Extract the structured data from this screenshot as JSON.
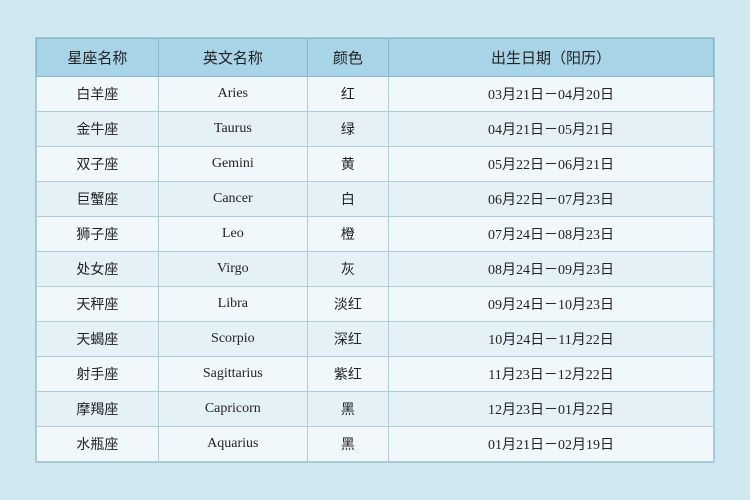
{
  "table": {
    "headers": [
      {
        "key": "cn_name",
        "label": "星座名称"
      },
      {
        "key": "en_name",
        "label": "英文名称"
      },
      {
        "key": "color",
        "label": "颜色"
      },
      {
        "key": "date_range",
        "label": "出生日期（阳历）"
      }
    ],
    "rows": [
      {
        "cn_name": "白羊座",
        "en_name": "Aries",
        "color": "红",
        "date_range": "03月21日－04月20日"
      },
      {
        "cn_name": "金牛座",
        "en_name": "Taurus",
        "color": "绿",
        "date_range": "04月21日－05月21日"
      },
      {
        "cn_name": "双子座",
        "en_name": "Gemini",
        "color": "黄",
        "date_range": "05月22日－06月21日"
      },
      {
        "cn_name": "巨蟹座",
        "en_name": "Cancer",
        "color": "白",
        "date_range": "06月22日－07月23日"
      },
      {
        "cn_name": "狮子座",
        "en_name": "Leo",
        "color": "橙",
        "date_range": "07月24日－08月23日"
      },
      {
        "cn_name": "处女座",
        "en_name": "Virgo",
        "color": "灰",
        "date_range": "08月24日－09月23日"
      },
      {
        "cn_name": "天秤座",
        "en_name": "Libra",
        "color": "淡红",
        "date_range": "09月24日－10月23日"
      },
      {
        "cn_name": "天蝎座",
        "en_name": "Scorpio",
        "color": "深红",
        "date_range": "10月24日－11月22日"
      },
      {
        "cn_name": "射手座",
        "en_name": "Sagittarius",
        "color": "紫红",
        "date_range": "11月23日－12月22日"
      },
      {
        "cn_name": "摩羯座",
        "en_name": "Capricorn",
        "color": "黑",
        "date_range": "12月23日－01月22日"
      },
      {
        "cn_name": "水瓶座",
        "en_name": "Aquarius",
        "color": "黑",
        "date_range": "01月21日－02月19日"
      }
    ]
  }
}
